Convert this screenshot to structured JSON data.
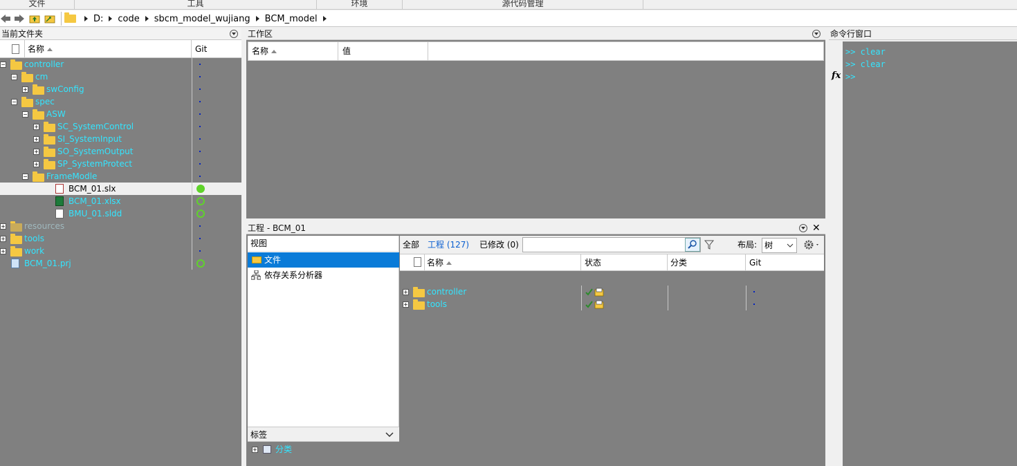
{
  "menu_sections": [
    "文件",
    "工具",
    "环境",
    "源代码管理"
  ],
  "address": {
    "crumbs": [
      "D:",
      "code",
      "sbcm_model_wujiang",
      "BCM_model"
    ]
  },
  "current_folder": {
    "title": "当前文件夹",
    "columns": {
      "name": "名称",
      "git": "Git"
    },
    "rows": [
      {
        "name": "controller",
        "indent": 0,
        "exp": "−",
        "type": "folder",
        "git": "dot"
      },
      {
        "name": "cm",
        "indent": 1,
        "exp": "−",
        "type": "folder",
        "git": "dot"
      },
      {
        "name": "swConfig",
        "indent": 2,
        "exp": "+",
        "type": "folder",
        "git": "dot"
      },
      {
        "name": "spec",
        "indent": 1,
        "exp": "−",
        "type": "folder",
        "git": "dot"
      },
      {
        "name": "ASW",
        "indent": 2,
        "exp": "−",
        "type": "folder",
        "git": "dot"
      },
      {
        "name": "SC_SystemControl",
        "indent": 3,
        "exp": "+",
        "type": "folder",
        "git": "dot"
      },
      {
        "name": "SI_SystemInput",
        "indent": 3,
        "exp": "+",
        "type": "folder",
        "git": "dot"
      },
      {
        "name": "SO_SystemOutput",
        "indent": 3,
        "exp": "+",
        "type": "folder",
        "git": "dot"
      },
      {
        "name": "SP_SystemProtect",
        "indent": 3,
        "exp": "+",
        "type": "folder",
        "git": "dot"
      },
      {
        "name": "FrameModle",
        "indent": 2,
        "exp": "−",
        "type": "folder",
        "git": "dot"
      },
      {
        "name": "BCM_01.slx",
        "indent": 4,
        "exp": "",
        "type": "slx",
        "git": "filled",
        "selected": true
      },
      {
        "name": "BCM_01.xlsx",
        "indent": 4,
        "exp": "",
        "type": "xlsx",
        "git": "ring"
      },
      {
        "name": "BMU_01.sldd",
        "indent": 4,
        "exp": "",
        "type": "sldd",
        "git": "ring"
      },
      {
        "name": "resources",
        "indent": 0,
        "exp": "+",
        "type": "folder-dim",
        "git": "dot"
      },
      {
        "name": "tools",
        "indent": 0,
        "exp": "+",
        "type": "folder",
        "git": "dot"
      },
      {
        "name": "work",
        "indent": 0,
        "exp": "+",
        "type": "folder",
        "git": "dot"
      },
      {
        "name": "BCM_01.prj",
        "indent": 0,
        "exp": "",
        "type": "prj",
        "git": "ring"
      }
    ]
  },
  "workspace": {
    "title": "工作区",
    "columns": {
      "name": "名称",
      "value": "值"
    }
  },
  "project": {
    "title": "工程 - BCM_01",
    "view_label": "视图",
    "views": [
      {
        "label": "文件",
        "selected": true
      },
      {
        "label": "依存关系分析器",
        "selected": false
      }
    ],
    "filters": {
      "all": "全部",
      "project": "工程 (127)",
      "modified": "已修改 (0)"
    },
    "search_value": "",
    "layout_label": "布局:",
    "layout_value": "树",
    "columns": {
      "name": "名称",
      "status": "状态",
      "category": "分类",
      "git": "Git"
    },
    "rows": [
      {
        "name": "controller"
      },
      {
        "name": "tools"
      }
    ],
    "tags_label": "标签",
    "tag_item": "分类"
  },
  "command_window": {
    "title": "命令行窗口",
    "fx": "fx",
    "lines": [
      ">> clear",
      ">> clear",
      ">>"
    ]
  },
  "colors": {
    "tree_text": "#33e5ff",
    "selection": "#0a7bd8",
    "panel_bg": "#808080",
    "git_green": "#5fd32a"
  }
}
